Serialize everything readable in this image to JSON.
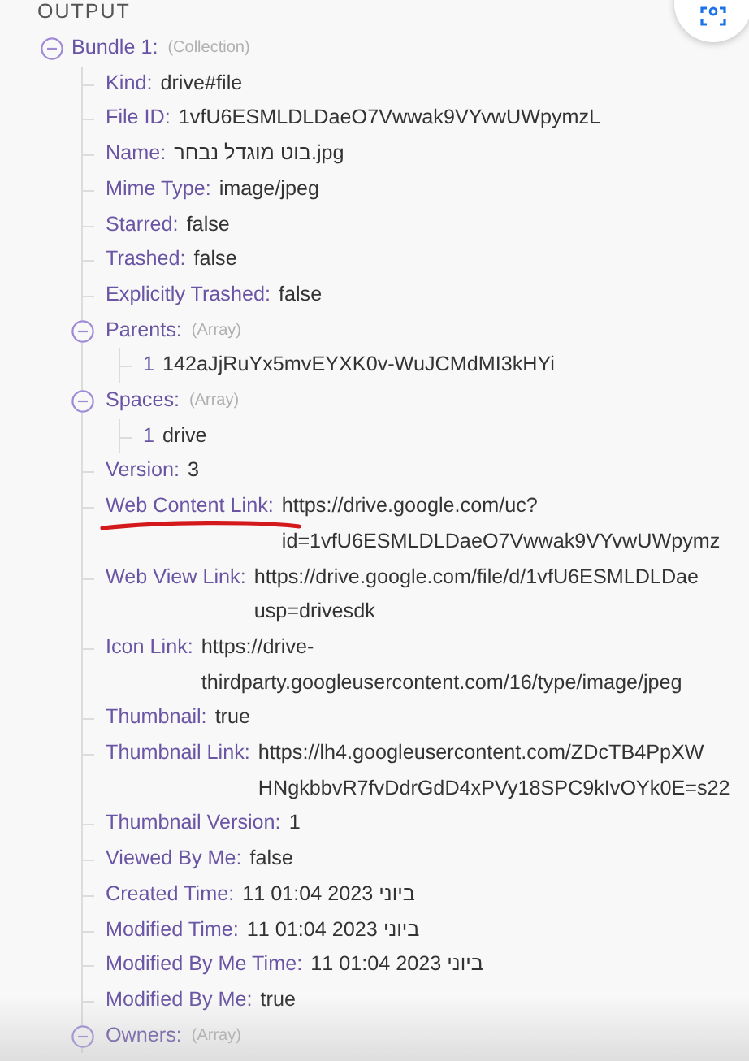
{
  "panel": {
    "title": "OUTPUT"
  },
  "tree": [
    {
      "kind": "group",
      "label": "Bundle 1:",
      "type_hint": "(Collection)",
      "expanded": true,
      "children": [
        {
          "kind": "field",
          "label": "Kind:",
          "value_lines": [
            "drive#file"
          ]
        },
        {
          "kind": "field",
          "label": "File ID:",
          "value_lines": [
            "1vfU6ESMLDLDaeO7Vwwak9VYvwUWpymzL"
          ]
        },
        {
          "kind": "field",
          "label": "Name:",
          "value_lines": [
            "בוט מוגדל נבחר.jpg"
          ]
        },
        {
          "kind": "field",
          "label": "Mime Type:",
          "value_lines": [
            "image/jpeg"
          ]
        },
        {
          "kind": "field",
          "label": "Starred:",
          "value_lines": [
            "false"
          ]
        },
        {
          "kind": "field",
          "label": "Trashed:",
          "value_lines": [
            "false"
          ]
        },
        {
          "kind": "field",
          "label": "Explicitly Trashed:",
          "value_lines": [
            "false"
          ]
        },
        {
          "kind": "group",
          "label": "Parents:",
          "type_hint": "(Array)",
          "expanded": true,
          "children": [
            {
              "kind": "item",
              "index": "1",
              "value_lines": [
                "142aJjRuYx5mvEYXK0v-WuJCMdMI3kHYi"
              ]
            }
          ]
        },
        {
          "kind": "group",
          "label": "Spaces:",
          "type_hint": "(Array)",
          "expanded": true,
          "children": [
            {
              "kind": "item",
              "index": "1",
              "value_lines": [
                "drive"
              ]
            }
          ]
        },
        {
          "kind": "field",
          "label": "Version:",
          "value_lines": [
            "3"
          ]
        },
        {
          "kind": "field",
          "label": "Web Content Link:",
          "annotated": true,
          "value_lines": [
            "https://drive.google.com/uc?",
            "id=1vfU6ESMLDLDaeO7Vwwak9VYvwUWpymz"
          ]
        },
        {
          "kind": "field",
          "label": "Web View Link:",
          "value_lines": [
            "https://drive.google.com/file/d/1vfU6ESMLDLDae",
            "usp=drivesdk"
          ]
        },
        {
          "kind": "field",
          "label": "Icon Link:",
          "value_lines": [
            "https://drive-",
            "thirdparty.googleusercontent.com/16/type/image/jpeg"
          ]
        },
        {
          "kind": "field",
          "label": "Thumbnail:",
          "value_lines": [
            "true"
          ]
        },
        {
          "kind": "field",
          "label": "Thumbnail Link:",
          "value_lines": [
            "https://lh4.googleusercontent.com/ZDcTB4PpXW",
            "HNgkbbvR7fvDdrGdD4xPVy18SPC9kIvOYk0E=s22"
          ]
        },
        {
          "kind": "field",
          "label": "Thumbnail Version:",
          "value_lines": [
            "1"
          ]
        },
        {
          "kind": "field",
          "label": "Viewed By Me:",
          "value_lines": [
            "false"
          ]
        },
        {
          "kind": "field",
          "label": "Created Time:",
          "value_lines": [
            "ביוני 2023 01:04 11"
          ]
        },
        {
          "kind": "field",
          "label": "Modified Time:",
          "value_lines": [
            "ביוני 2023 01:04 11"
          ]
        },
        {
          "kind": "field",
          "label": "Modified By Me Time:",
          "value_lines": [
            "ביוני 2023 01:04 11"
          ]
        },
        {
          "kind": "field",
          "label": "Modified By Me:",
          "value_lines": [
            "true"
          ]
        },
        {
          "kind": "group",
          "label": "Owners:",
          "type_hint": "(Array)",
          "expanded": true
        }
      ]
    }
  ]
}
